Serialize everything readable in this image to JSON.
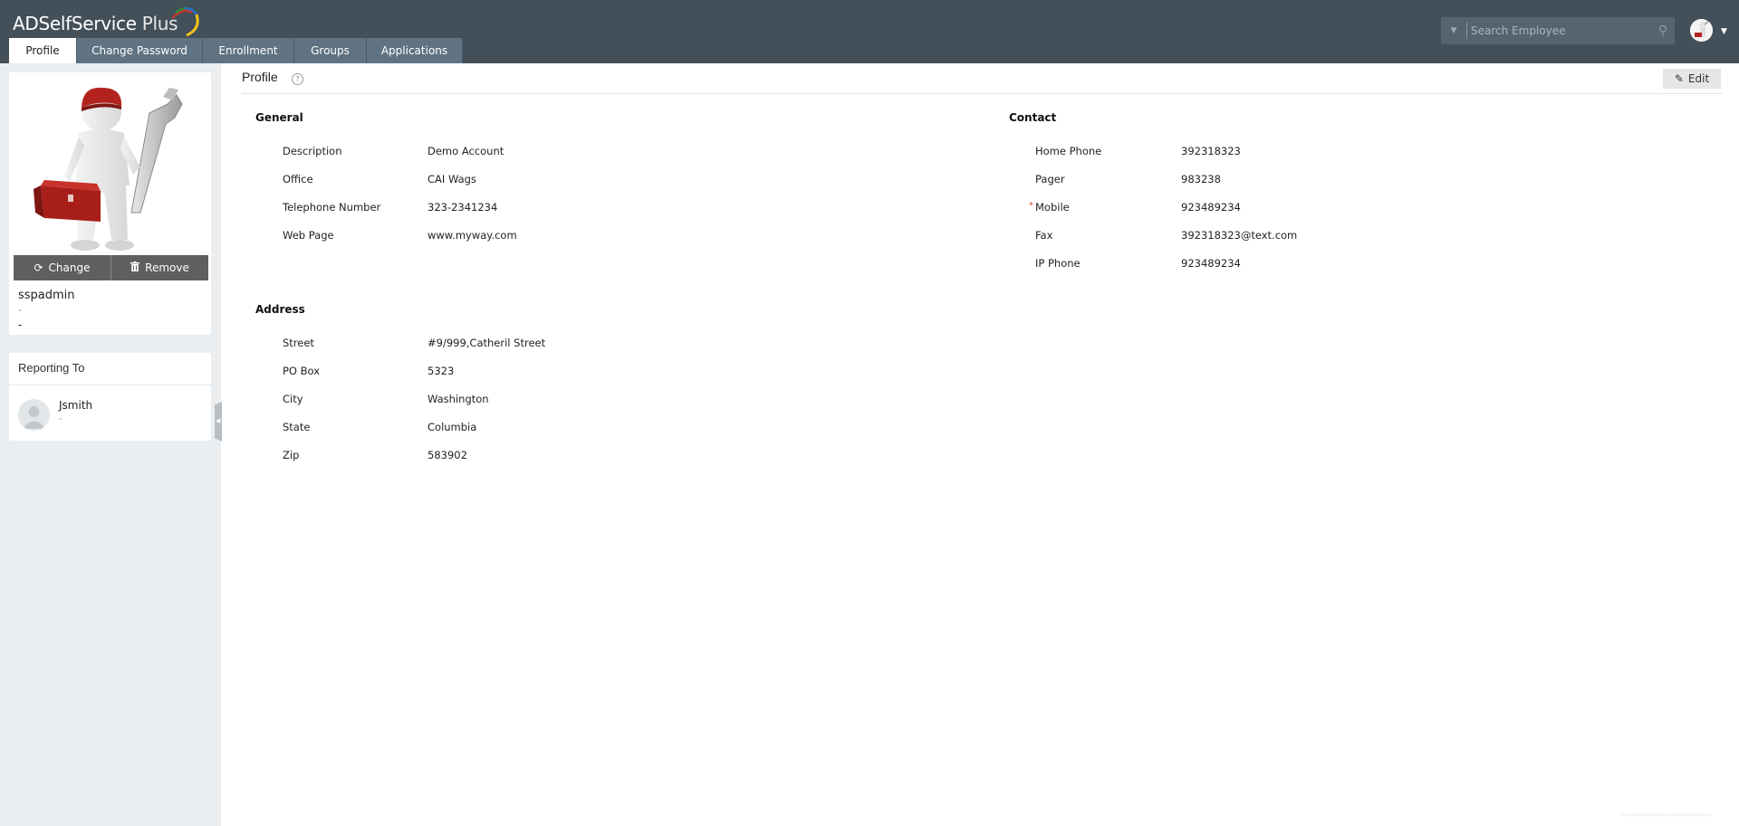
{
  "app": {
    "logo_text": "ADSelfService",
    "logo_plus": "Plus"
  },
  "tabs": [
    {
      "label": "Profile",
      "active": true
    },
    {
      "label": "Change Password",
      "active": false
    },
    {
      "label": "Enrollment",
      "active": false
    },
    {
      "label": "Groups",
      "active": false
    },
    {
      "label": "Applications",
      "active": false
    }
  ],
  "search": {
    "placeholder": "Search Employee",
    "value": ""
  },
  "sidebar": {
    "photo_actions": {
      "change": "Change",
      "remove": "Remove"
    },
    "username": "sspadmin",
    "line1": "-",
    "line2": "-",
    "reporting_to": {
      "title": "Reporting To",
      "name": "Jsmith",
      "sub": "-"
    }
  },
  "main": {
    "title": "Profile",
    "help_icon": "?",
    "edit_label": "Edit",
    "general": {
      "heading": "General",
      "fields": [
        {
          "label": "Description",
          "value": "Demo Account"
        },
        {
          "label": "Office",
          "value": "CAI Wags"
        },
        {
          "label": "Telephone Number",
          "value": "323-2341234"
        },
        {
          "label": "Web Page",
          "value": "www.myway.com"
        }
      ]
    },
    "address": {
      "heading": "Address",
      "fields": [
        {
          "label": "Street",
          "value": "#9/999,Catheril Street"
        },
        {
          "label": "PO Box",
          "value": "5323"
        },
        {
          "label": "City",
          "value": "Washington"
        },
        {
          "label": "State",
          "value": "Columbia"
        },
        {
          "label": "Zip",
          "value": "583902"
        }
      ]
    },
    "contact": {
      "heading": "Contact",
      "required_marker": "*",
      "fields": [
        {
          "label": "Home Phone",
          "value": "392318323",
          "required": false
        },
        {
          "label": "Pager",
          "value": "983238",
          "required": false
        },
        {
          "label": "Mobile",
          "value": "923489234",
          "required": true
        },
        {
          "label": "Fax",
          "value": "392318323@text.com",
          "required": false
        },
        {
          "label": "IP Phone",
          "value": "923489234",
          "required": false
        }
      ]
    }
  },
  "colors": {
    "topbar": "#434f59",
    "tab_inactive": "#5f7382",
    "sidebar_bg": "#ebeef0",
    "required": "#e04a3f"
  }
}
